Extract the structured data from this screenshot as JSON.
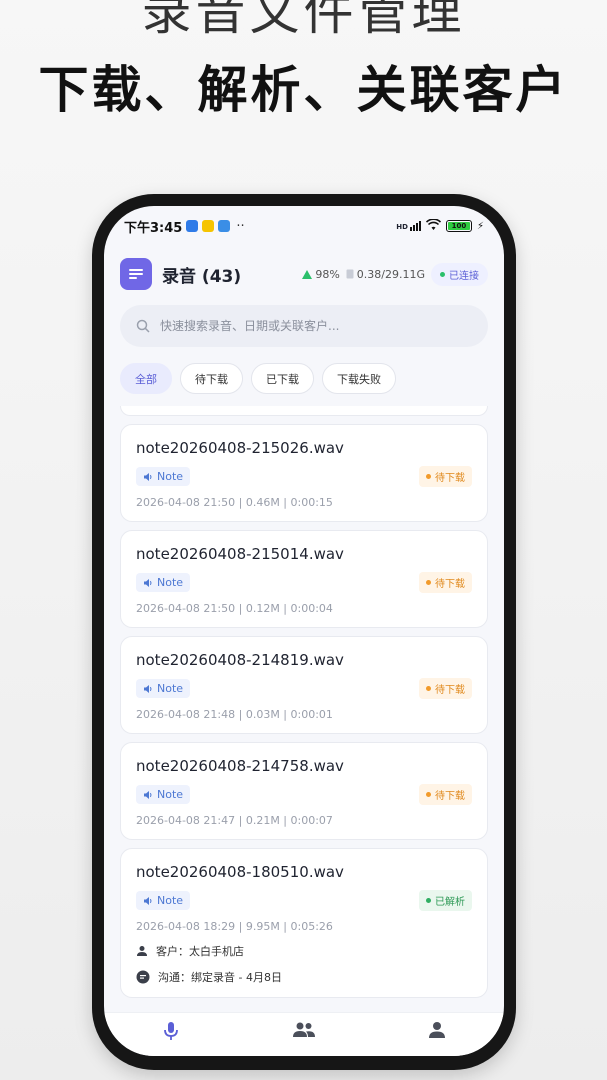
{
  "promo": {
    "top_line": "录音文件管理",
    "main_line": "下载、解析、关联客户"
  },
  "status_bar": {
    "time": "下午3:45",
    "dots": "··",
    "signal": "HD",
    "battery": "100"
  },
  "header": {
    "title": "录音 (43)",
    "battery_pct": "98%",
    "storage": "0.38/29.11G",
    "connection": "已连接"
  },
  "search": {
    "placeholder": "快速搜索录音、日期或关联客户..."
  },
  "filters": [
    {
      "label": "全部",
      "active": true
    },
    {
      "label": "待下载",
      "active": false
    },
    {
      "label": "已下载",
      "active": false
    },
    {
      "label": "下载失败",
      "active": false
    }
  ],
  "recordings": [
    {
      "filename": "note20260408-215026.wav",
      "tag": "Note",
      "status": "待下载",
      "meta": "2026-04-08 21:50 | 0.46M | 0:00:15"
    },
    {
      "filename": "note20260408-215014.wav",
      "tag": "Note",
      "status": "待下载",
      "meta": "2026-04-08 21:50 | 0.12M | 0:00:04"
    },
    {
      "filename": "note20260408-214819.wav",
      "tag": "Note",
      "status": "待下载",
      "meta": "2026-04-08 21:48 | 0.03M | 0:00:01"
    },
    {
      "filename": "note20260408-214758.wav",
      "tag": "Note",
      "status": "待下载",
      "meta": "2026-04-08 21:47 | 0.21M | 0:00:07"
    },
    {
      "filename": "note20260408-180510.wav",
      "tag": "Note",
      "status": "已解析",
      "meta": "2026-04-08 18:29 | 9.95M | 0:05:26",
      "customer": "客户：太白手机店",
      "communication": "沟通：绑定录音 - 4月8日"
    }
  ],
  "colors": {
    "accent": "#7067e6",
    "pending": "#f29a2a",
    "parsed": "#2fae62",
    "tag": "#4d78d3"
  },
  "tabbar": [
    "mic-icon",
    "people-icon",
    "person-icon"
  ]
}
